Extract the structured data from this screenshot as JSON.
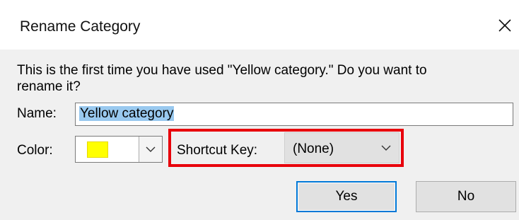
{
  "window": {
    "title": "Rename Category"
  },
  "message": "This is the first time you have used \"Yellow category.\" Do you want to\nrename it?",
  "name_field": {
    "label": "Name:",
    "value": "Yellow category"
  },
  "color_field": {
    "label": "Color:",
    "swatch_color": "#ffff00"
  },
  "shortcut_field": {
    "label": "Shortcut Key:",
    "value": "(None)"
  },
  "buttons": {
    "yes": "Yes",
    "no": "No"
  },
  "colors": {
    "highlight": "#e8000b",
    "focus": "#0078d7",
    "selection": "#99c9ef"
  }
}
